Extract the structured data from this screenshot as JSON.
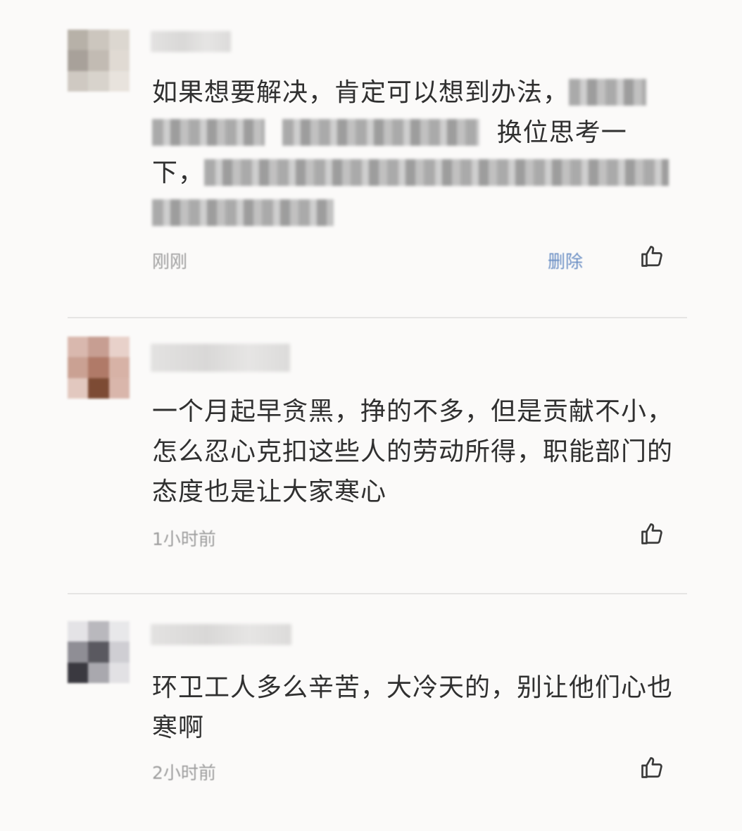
{
  "comments": [
    {
      "body_segments": [
        "如果想要解决，肯定可以想到办法，",
        "",
        "换位思考一",
        "下，",
        ""
      ],
      "time": "刚刚",
      "delete_label": "删除",
      "like_icon": "thumbs-up-icon",
      "avatar_icon": "avatar-blurred",
      "avatar_colors": [
        "#b7b1a8",
        "#ccc6be",
        "#dcd7d0",
        "#a8a19a",
        "#c2bbb3",
        "#e0dad3",
        "#cfc9c2",
        "#d8d3cc",
        "#e8e3dd"
      ]
    },
    {
      "body": "一个月起早贪黑，挣的不多，但是贡献不小，怎么忍心克扣这些人的劳动所得，职能部门的态度也是让大家寒心",
      "time": "1小时前",
      "like_icon": "thumbs-up-icon",
      "avatar_icon": "avatar-blurred",
      "avatar_colors": [
        "#d9b8ae",
        "#c79e92",
        "#e8d1ca",
        "#caa193",
        "#b07a68",
        "#d7b2a6",
        "#e2c8bf",
        "#7d4b34",
        "#d9b6ab"
      ]
    },
    {
      "body": "环卫工人多么辛苦，大冷天的，别让他们心也寒啊",
      "time": "2小时前",
      "like_icon": "thumbs-up-icon",
      "avatar_icon": "avatar-blurred",
      "avatar_colors": [
        "#e4e3e6",
        "#b9b8bd",
        "#e8e8ea",
        "#8f8e95",
        "#5a5960",
        "#cfced3",
        "#3a3940",
        "#a9a8ae",
        "#e2e1e4"
      ]
    }
  ]
}
